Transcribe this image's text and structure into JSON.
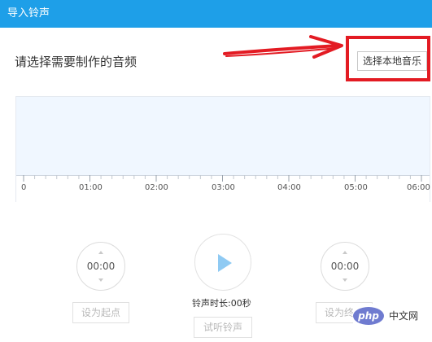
{
  "window": {
    "title": "导入铃声"
  },
  "prompt": "请选择需要制作的音频",
  "choose_local_button": "选择本地音乐",
  "timeline": {
    "labels": [
      "0",
      "01:00",
      "02:00",
      "03:00",
      "04:00",
      "05:00",
      "06:00"
    ]
  },
  "start_dial": {
    "value": "00:00"
  },
  "end_dial": {
    "value": "00:00"
  },
  "duration_text": "铃声时长:00秒",
  "buttons": {
    "set_start": "设为起点",
    "preview": "试听铃声",
    "set_end": "设为终点"
  },
  "watermark": {
    "logo": "php",
    "text": "中文网"
  },
  "colors": {
    "titlebar": "#1e9fe8",
    "annotation_red": "#e31b23",
    "waveform_bg": "#f0f7ff",
    "play_accent": "#8fcaf3"
  }
}
